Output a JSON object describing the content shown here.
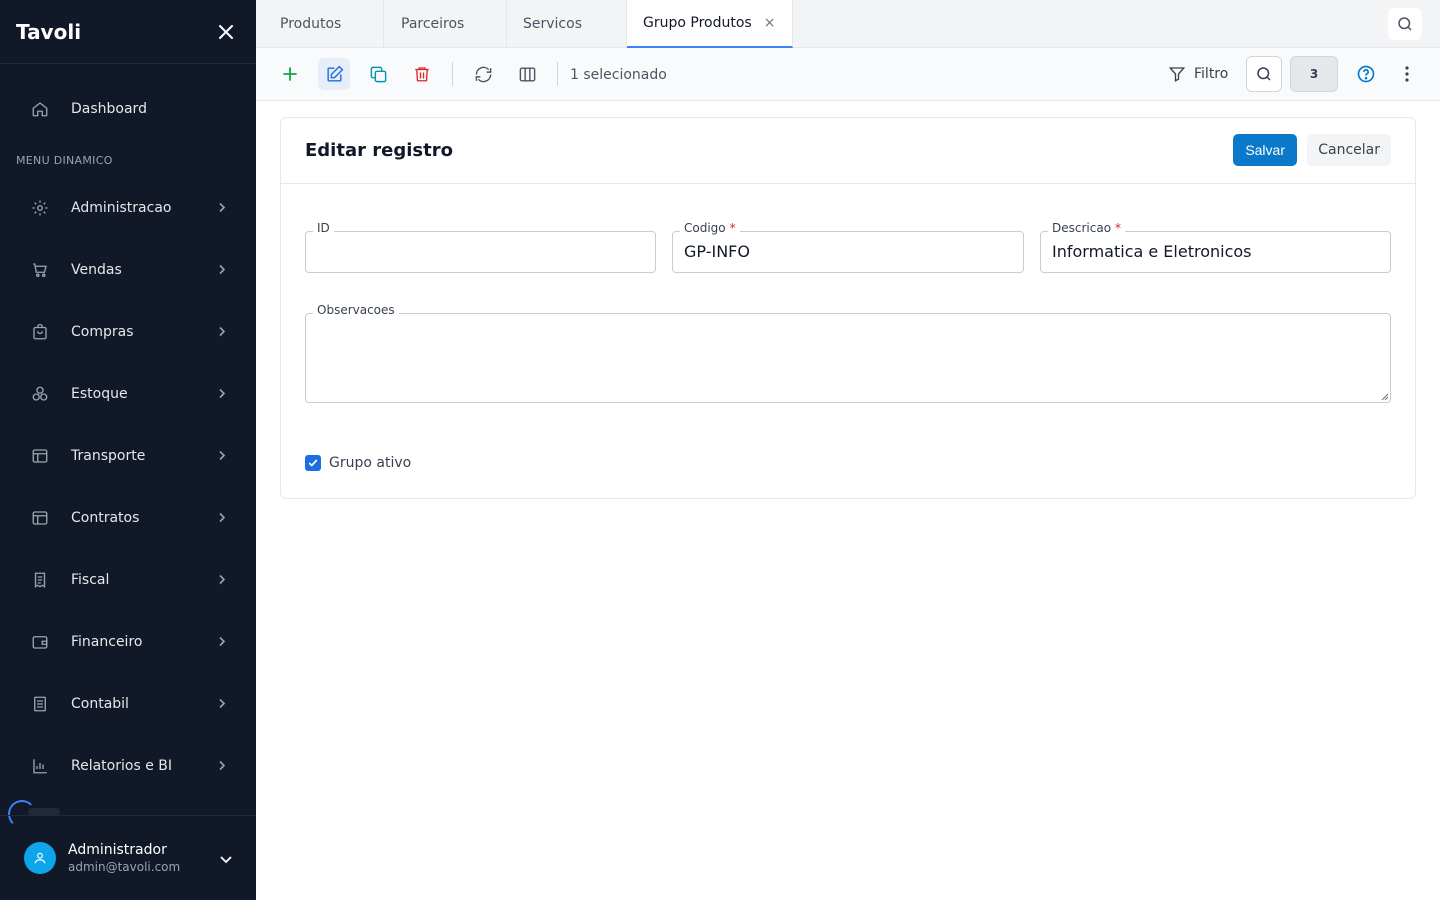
{
  "sidebar": {
    "brand": "Tavoli",
    "dashboard_label": "Dashboard",
    "section_title": "MENU DINAMICO",
    "items": [
      {
        "label": "Administracao",
        "icon": "gear-icon"
      },
      {
        "label": "Vendas",
        "icon": "cart-icon"
      },
      {
        "label": "Compras",
        "icon": "bag-icon"
      },
      {
        "label": "Estoque",
        "icon": "boxes-icon"
      },
      {
        "label": "Transporte",
        "icon": "layout-icon"
      },
      {
        "label": "Contratos",
        "icon": "layout-icon"
      },
      {
        "label": "Fiscal",
        "icon": "receipt-icon"
      },
      {
        "label": "Financeiro",
        "icon": "wallet-icon"
      },
      {
        "label": "Contabil",
        "icon": "ledger-icon"
      },
      {
        "label": "Relatorios e BI",
        "icon": "bar-chart-icon"
      }
    ],
    "user": {
      "name": "Administrador",
      "email": "admin@tavoli.com"
    }
  },
  "tabs": [
    {
      "label": "Produtos",
      "active": false
    },
    {
      "label": "Parceiros",
      "active": false
    },
    {
      "label": "Servicos",
      "active": false
    },
    {
      "label": "Grupo Produtos",
      "active": true
    }
  ],
  "toolbar": {
    "selection_text": "1 selecionado",
    "filter_label": "Filtro",
    "count_badge": "3"
  },
  "form": {
    "title": "Editar registro",
    "save_label": "Salvar",
    "cancel_label": "Cancelar",
    "fields": {
      "id": {
        "label": "ID",
        "value": ""
      },
      "codigo": {
        "label": "Codigo",
        "required_mark": "*",
        "value": "GP-INFO"
      },
      "descricao": {
        "label": "Descricao",
        "required_mark": "*",
        "value": "Informatica e Eletronicos"
      },
      "observacoes": {
        "label": "Observacoes",
        "value": ""
      }
    },
    "active_checkbox": {
      "label": "Grupo ativo",
      "checked": true
    }
  },
  "colors": {
    "sidebar_bg": "#111827",
    "primary": "#0b79c9",
    "accent_tab": "#3b82f6",
    "add_green": "#16a34a",
    "delete_red": "#dc2626",
    "copy_teal": "#0891b2"
  }
}
